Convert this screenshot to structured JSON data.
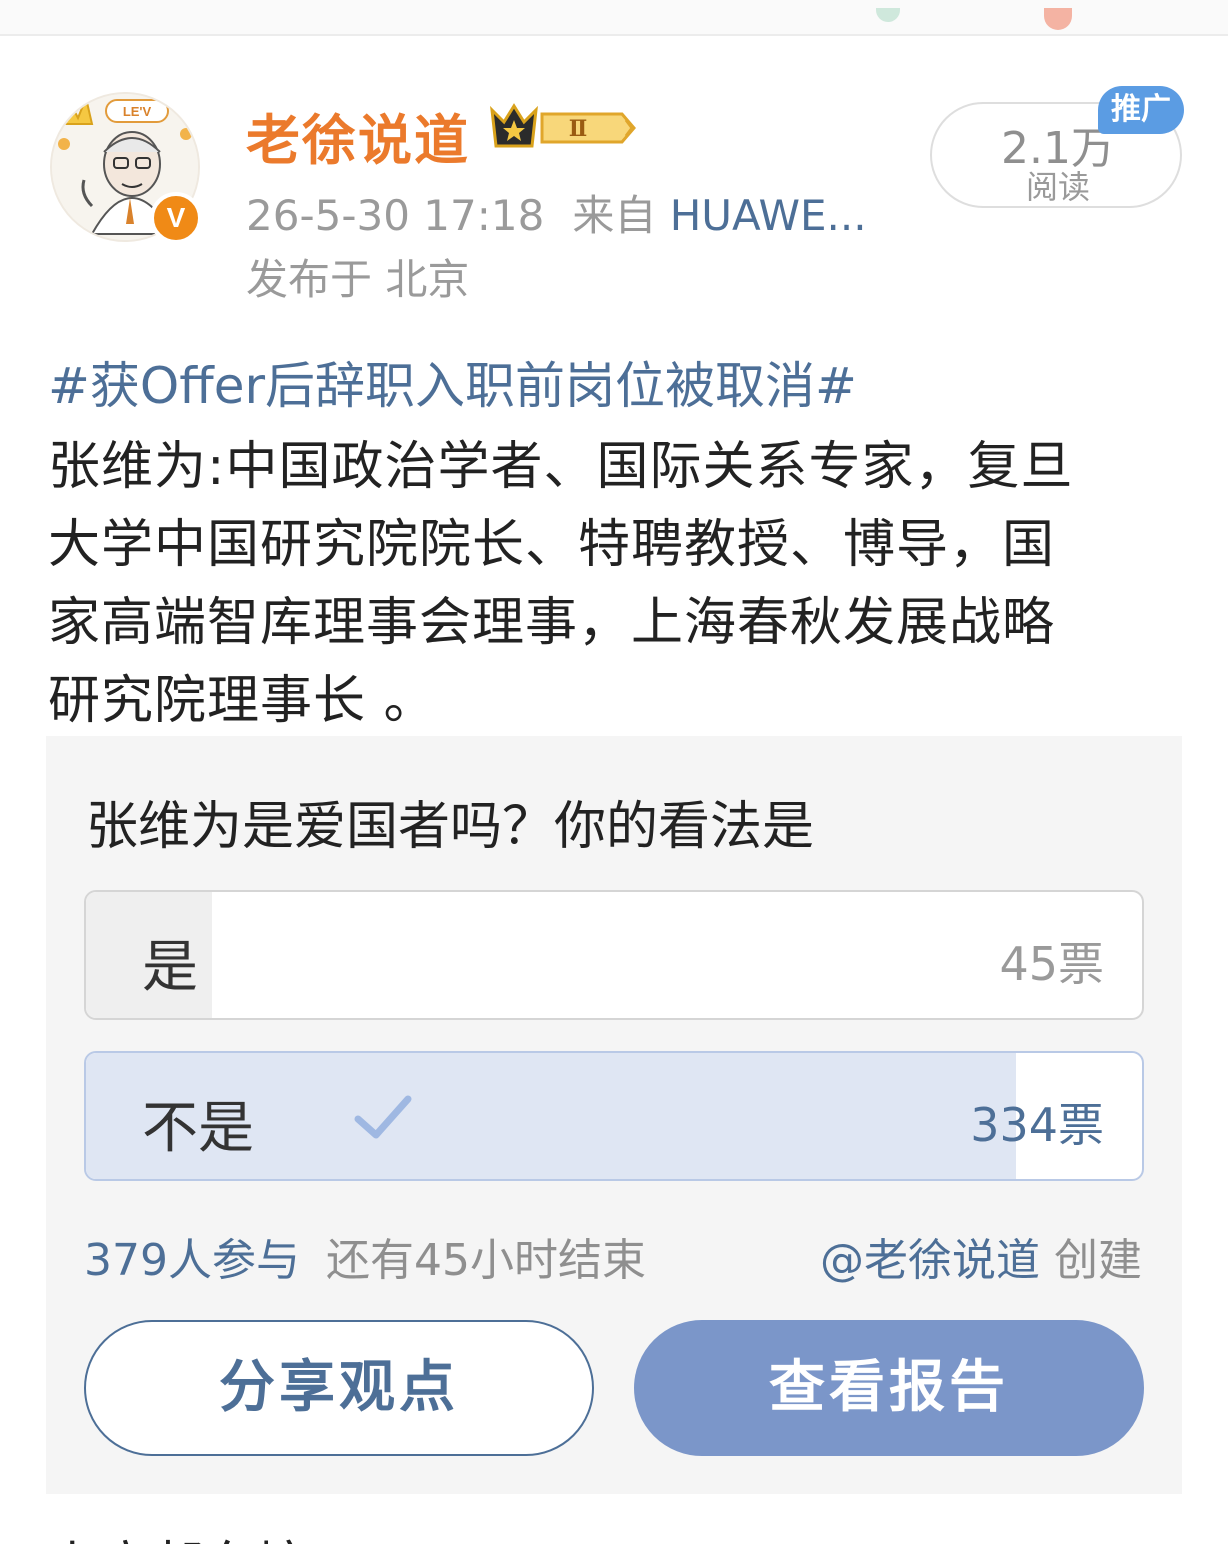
{
  "colors": {
    "username": "#eb7a2c",
    "link": "#4d6f97",
    "meta": "#9a9a9a",
    "promo_tag": "#5b9ce3",
    "report_button": "#7b96c9",
    "selected_option_fill": "#dfe6f3"
  },
  "post": {
    "username": "老徐说道",
    "vip_level": "Ⅱ",
    "time": "26-5-30 17:18",
    "source_prefix": "来自",
    "device": "HUAWE...",
    "location": "发布于 北京",
    "read_count": "2.1万",
    "read_label": "阅读",
    "promo_tag": "推广",
    "hashtag": "#获Offer后辞职入职前岗位被取消#",
    "body_lines": [
      "张维为:中国政治学者、国际关系专家，复旦",
      "大学中国研究院院长、特聘教授、博导，国",
      "家高端智库理事会理事，上海春秋发展战略",
      "研究院理事长 。"
    ],
    "next_line": "上高邮东塘"
  },
  "poll": {
    "question": "张维为是爱国者吗？你的看法是",
    "options": [
      {
        "label": "是",
        "votes": "45票",
        "share": 0.119,
        "selected": false
      },
      {
        "label": "不是",
        "votes": "334票",
        "share": 0.881,
        "selected": true
      }
    ],
    "participants": "379人参与",
    "remaining": "还有45小时结束",
    "creator_mention": "@老徐说道",
    "creator_suffix": "创建",
    "share_button": "分享观点",
    "report_button": "查看报告"
  }
}
